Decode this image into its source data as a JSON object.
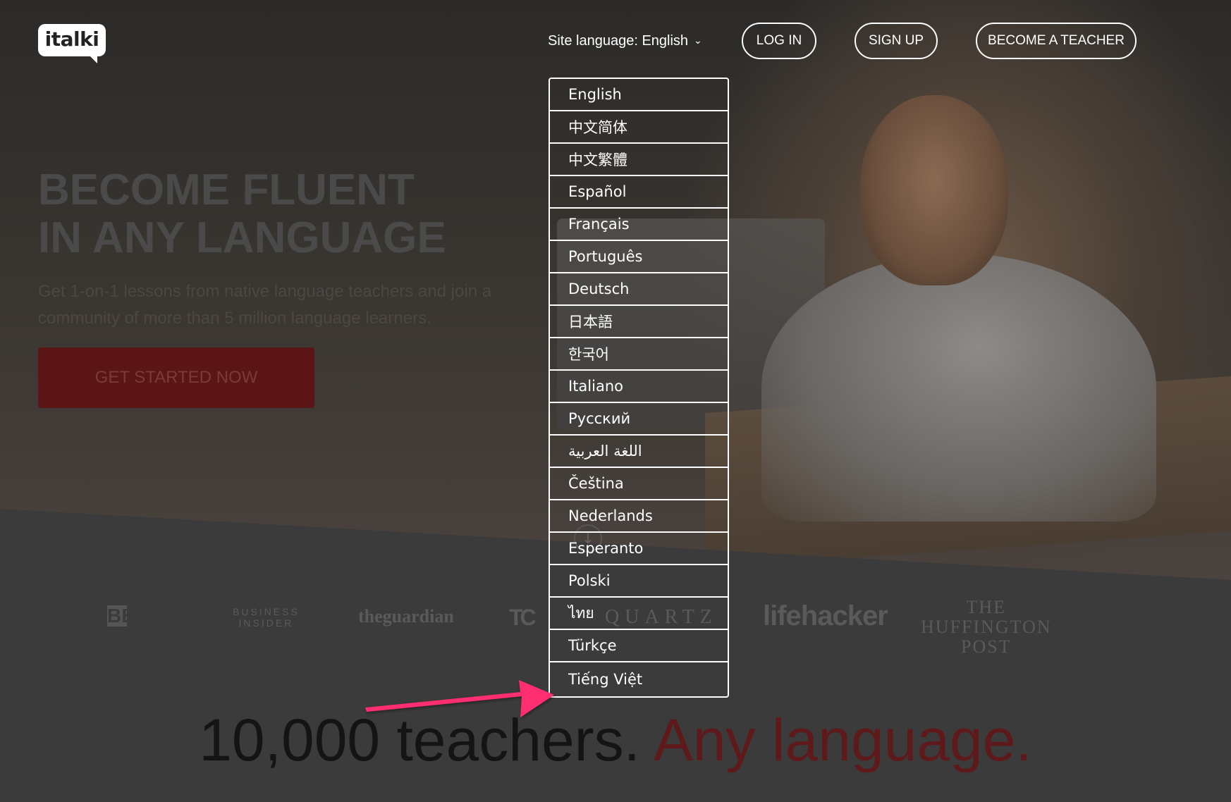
{
  "header": {
    "logo_text": "italki",
    "site_language_label": "Site language: English",
    "login_label": "LOG IN",
    "signup_label": "SIGN UP",
    "become_teacher_label": "BECOME A TEACHER"
  },
  "hero": {
    "title_line1": "BECOME FLUENT",
    "title_line2": "IN ANY LANGUAGE",
    "subtitle": "Get 1-on-1 lessons from native language teachers and join a community of more than 5 million language learners.",
    "cta_label": "GET STARTED NOW"
  },
  "language_dropdown": {
    "items": [
      "English",
      "中文简体",
      "中文繁體",
      "Español",
      "Français",
      "Português",
      "Deutsch",
      "日本語",
      "한국어",
      "Italiano",
      "Русский",
      "اللغة العربية",
      "Čeština",
      "Nederlands",
      "Esperanto",
      "Polski",
      "ไทย",
      "Türkçe",
      "Tiếng Việt"
    ]
  },
  "press": {
    "bbc": "BBC",
    "business_insider_line1": "BUSINESS",
    "business_insider_line2": "INSIDER",
    "guardian": "theguardian",
    "techcrunch": "TC",
    "quartz": "QUARTZ",
    "lifehacker": "lifehacker",
    "huffpost_line1": "THE",
    "huffpost_line2": "HUFFINGTON",
    "huffpost_line3": "POST"
  },
  "tagline": {
    "main": "10,000 teachers. ",
    "accent": "Any language."
  },
  "colors": {
    "arrow": "#ff2d6f",
    "accent": "#5e1a1a",
    "dropdown_border": "#ffffff"
  }
}
